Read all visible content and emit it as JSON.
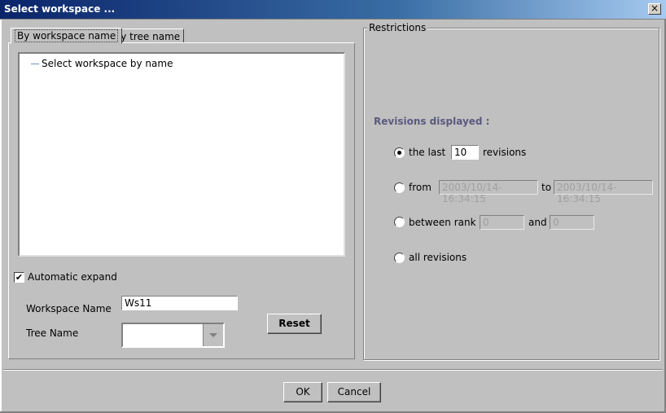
{
  "window": {
    "title": "Select workspace ...",
    "close_glyph": "×"
  },
  "tabs": [
    {
      "label": "By workspace name",
      "active": true
    },
    {
      "label": "By tree name",
      "active": false
    }
  ],
  "tree": {
    "root_label": "Select workspace by name"
  },
  "automatic_expand": {
    "label": "Automatic expand",
    "checked": true,
    "check_glyph": "✔"
  },
  "workspace_name": {
    "label": "Workspace Name",
    "value": "Ws11"
  },
  "tree_name": {
    "label": "Tree Name",
    "value": ""
  },
  "reset_label": "Reset",
  "restrictions": {
    "title": "Restrictions",
    "revisions_title": "Revisions displayed :",
    "options": {
      "last": {
        "prefix": "the last",
        "value": "10",
        "suffix": "revisions",
        "selected": true
      },
      "from": {
        "prefix": "from",
        "from_value": "2003/10/14-16:34:15",
        "to_label": "to",
        "to_value": "2003/10/14-16:34:15",
        "selected": false
      },
      "rank": {
        "prefix": "between rank",
        "from_value": "0",
        "and_label": "and",
        "to_value": "0",
        "selected": false
      },
      "all": {
        "label": "all revisions",
        "selected": false
      }
    }
  },
  "footer": {
    "ok_label": "OK",
    "cancel_label": "Cancel"
  }
}
